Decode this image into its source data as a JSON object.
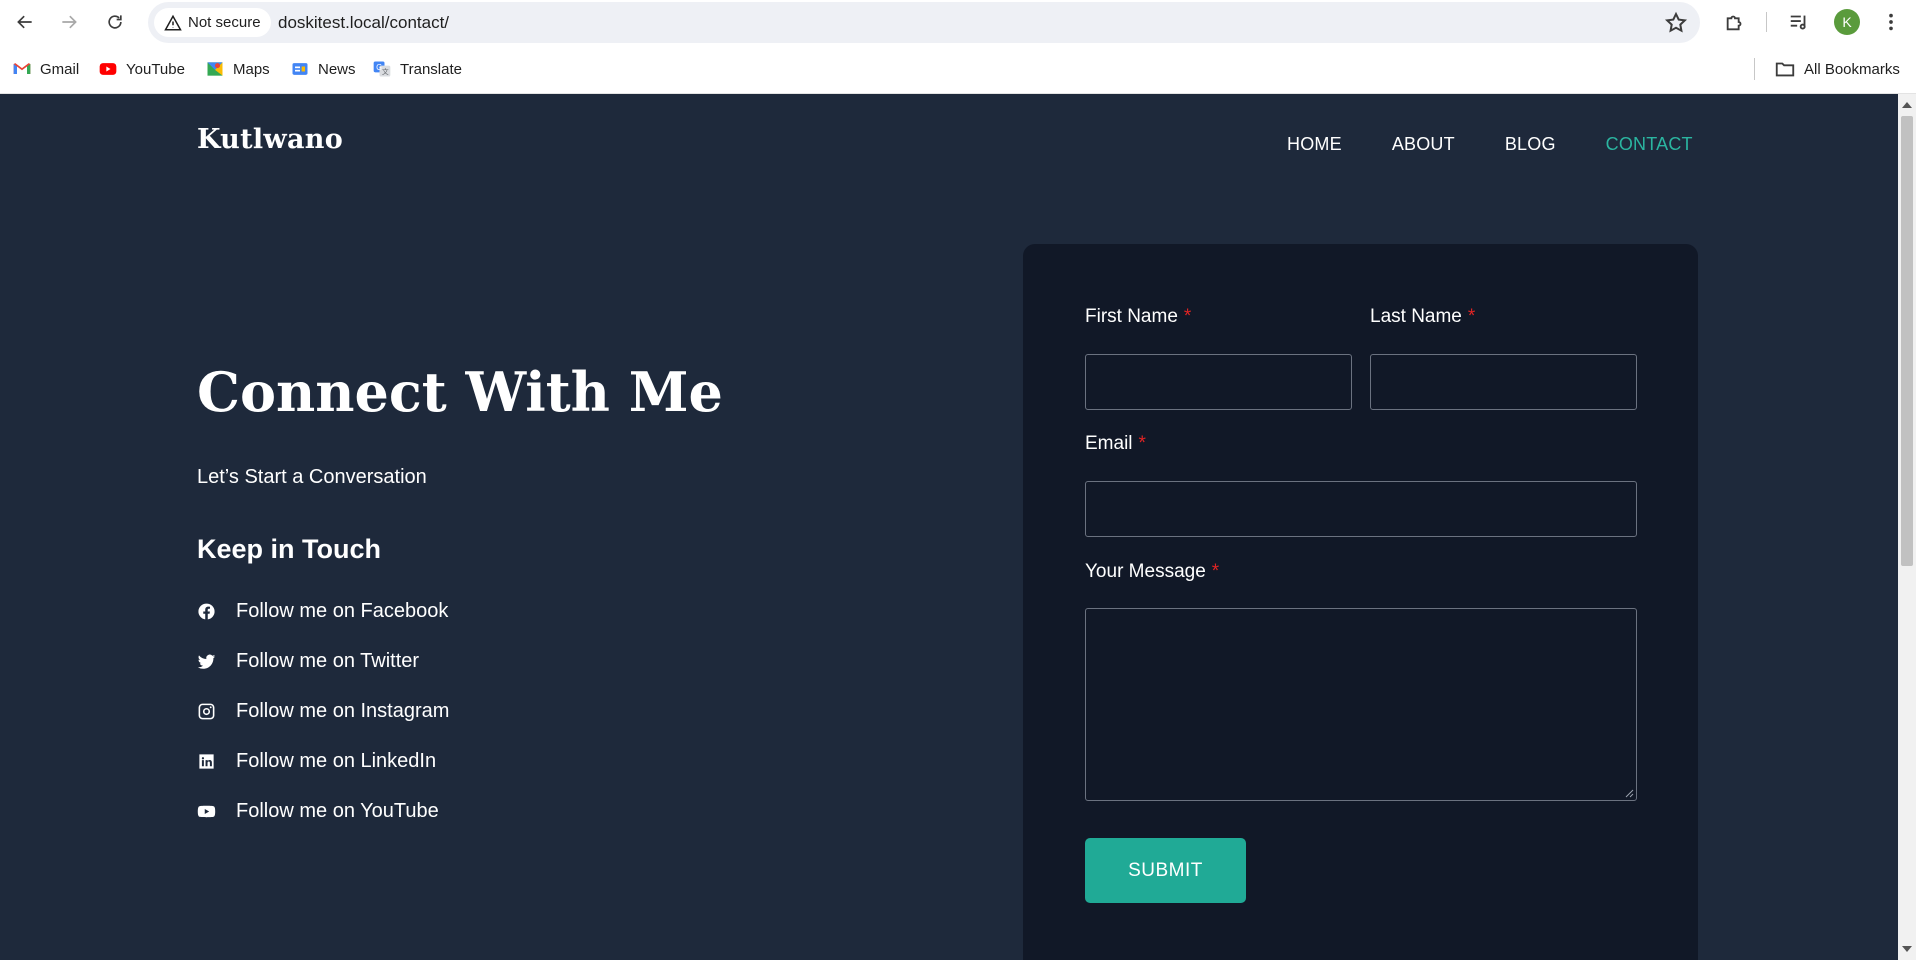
{
  "browser": {
    "security_label": "Not secure",
    "url": "doskitest.local/contact/",
    "profile_initial": "K",
    "bookmarks": [
      {
        "label": "Gmail",
        "icon": "gmail-icon"
      },
      {
        "label": "YouTube",
        "icon": "youtube-icon"
      },
      {
        "label": "Maps",
        "icon": "maps-icon"
      },
      {
        "label": "News",
        "icon": "news-icon"
      },
      {
        "label": "Translate",
        "icon": "translate-icon"
      }
    ],
    "all_bookmarks_label": "All Bookmarks"
  },
  "site": {
    "logo": "Kutlwano",
    "nav": [
      {
        "label": "HOME",
        "active": false
      },
      {
        "label": "ABOUT",
        "active": false
      },
      {
        "label": "BLOG",
        "active": false
      },
      {
        "label": "CONTACT",
        "active": true
      }
    ],
    "accent_color": "#2bb5a0",
    "background_color": "#1e293b"
  },
  "hero": {
    "title": "Connect With Me",
    "subtitle": "Let’s Start a Conversation",
    "keep_in_touch": "Keep in Touch",
    "social": [
      {
        "label": "Follow me on Facebook",
        "icon": "facebook-icon"
      },
      {
        "label": "Follow me on Twitter",
        "icon": "twitter-icon"
      },
      {
        "label": "Follow me on Instagram",
        "icon": "instagram-icon"
      },
      {
        "label": "Follow me on LinkedIn",
        "icon": "linkedin-icon"
      },
      {
        "label": "Follow me on YouTube",
        "icon": "youtube-icon"
      }
    ]
  },
  "form": {
    "first_name_label": "First Name",
    "last_name_label": "Last Name",
    "email_label": "Email",
    "message_label": "Your Message",
    "required_mark": "*",
    "first_name_value": "",
    "last_name_value": "",
    "email_value": "",
    "message_value": "",
    "submit_label": "SUBMIT",
    "submit_color": "#20aa96"
  }
}
